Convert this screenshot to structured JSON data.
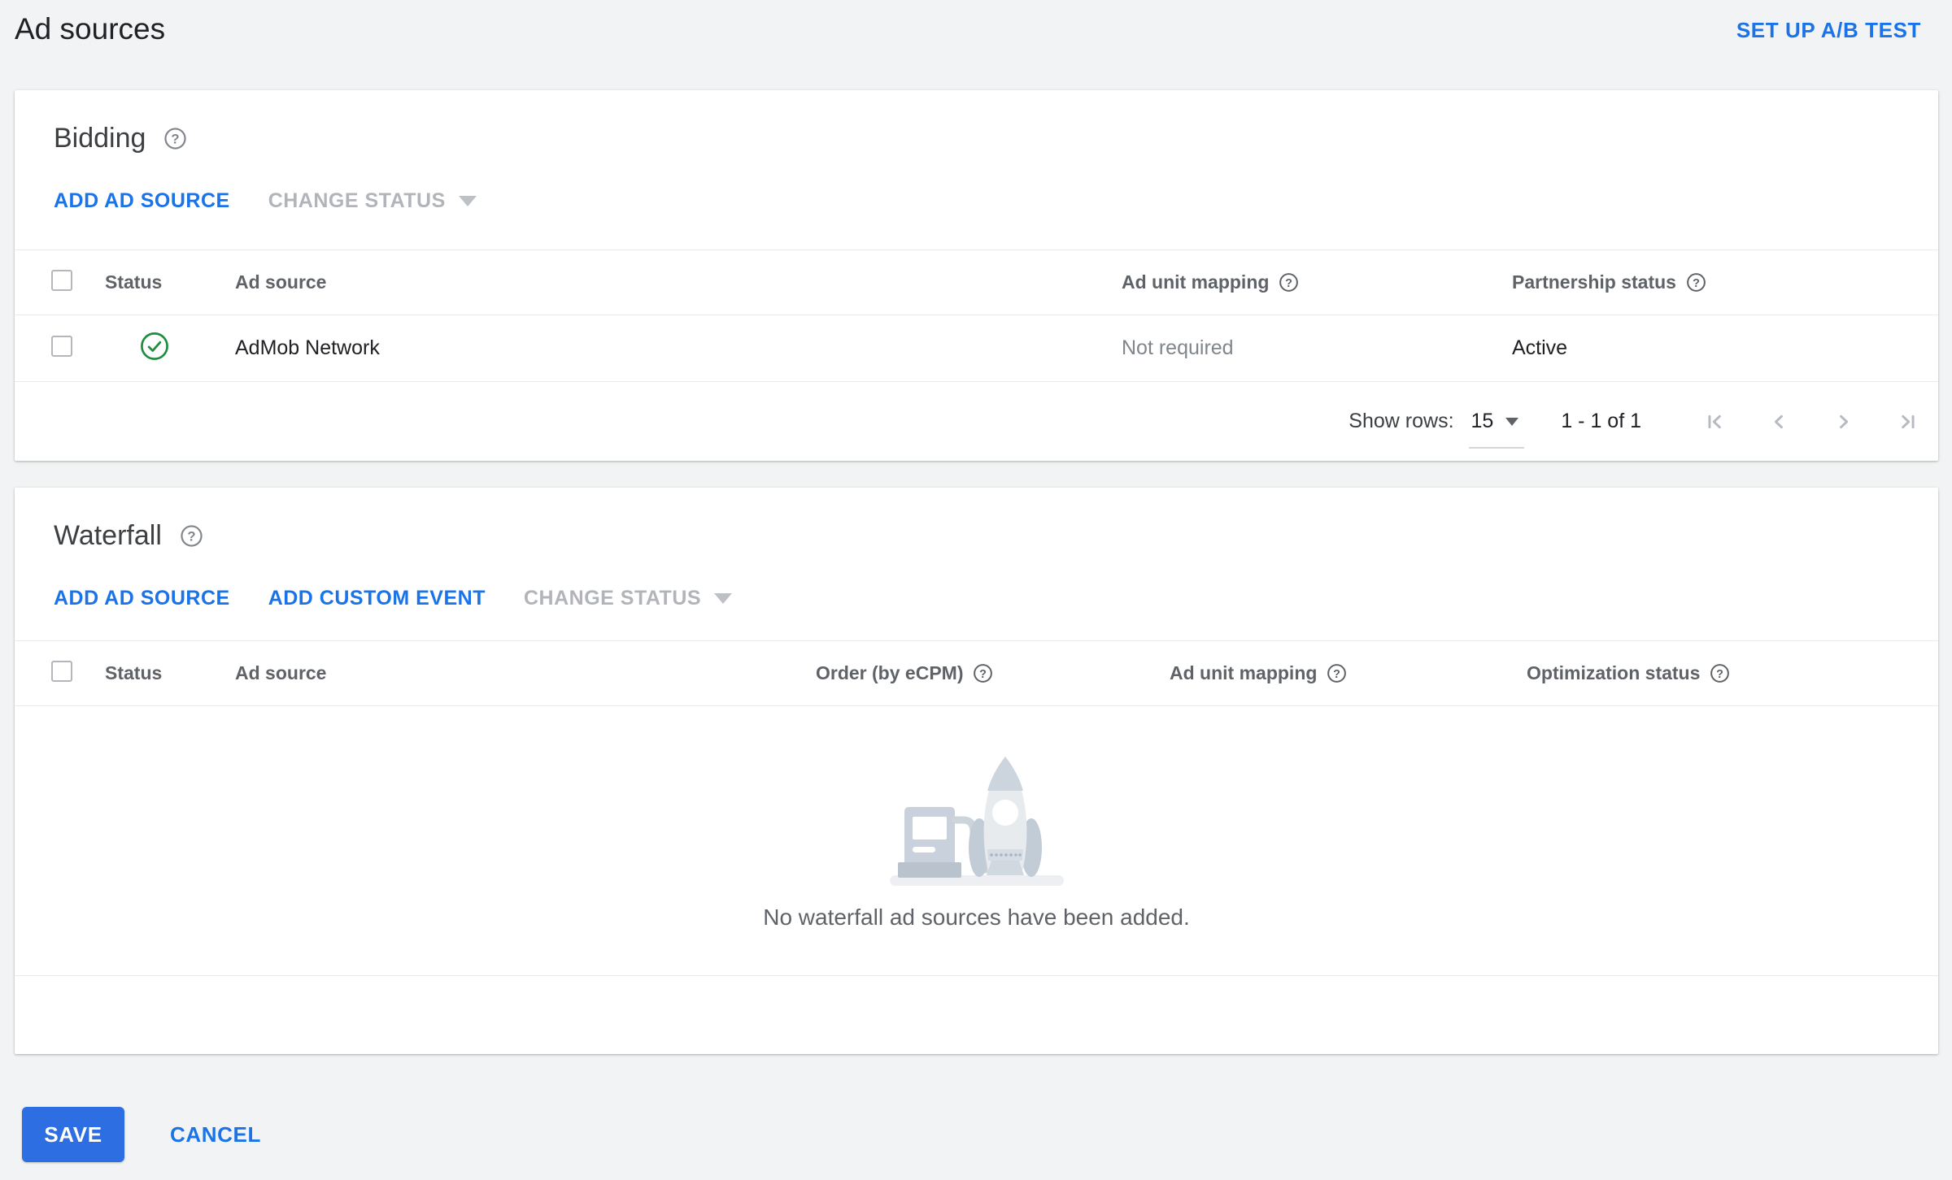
{
  "header": {
    "title": "Ad sources",
    "ab_test_link": "SET UP A/B TEST"
  },
  "bidding": {
    "title": "Bidding",
    "add_ad_source": "ADD AD SOURCE",
    "change_status": "CHANGE STATUS",
    "columns": {
      "status": "Status",
      "ad_source": "Ad source",
      "ad_unit_mapping": "Ad unit mapping",
      "partnership_status": "Partnership status"
    },
    "rows": [
      {
        "status": "active",
        "ad_source": "AdMob Network",
        "ad_unit_mapping": "Not required",
        "partnership_status": "Active"
      }
    ],
    "pagination": {
      "show_rows_label": "Show rows:",
      "rows_per_page": "15",
      "range": "1 - 1 of 1"
    }
  },
  "waterfall": {
    "title": "Waterfall",
    "add_ad_source": "ADD AD SOURCE",
    "add_custom_event": "ADD CUSTOM EVENT",
    "change_status": "CHANGE STATUS",
    "columns": {
      "status": "Status",
      "ad_source": "Ad source",
      "order": "Order (by eCPM)",
      "ad_unit_mapping": "Ad unit mapping",
      "optimization_status": "Optimization status"
    },
    "empty_message": "No waterfall ad sources have been added."
  },
  "footer": {
    "save": "SAVE",
    "cancel": "CANCEL"
  },
  "colors": {
    "page_background": "#f1f3f4",
    "link_blue": "#1a73e8",
    "save_button_blue": "#2d6ee3",
    "active_green": "#1e8e3e",
    "disabled_gray": "#b1b5ba"
  }
}
